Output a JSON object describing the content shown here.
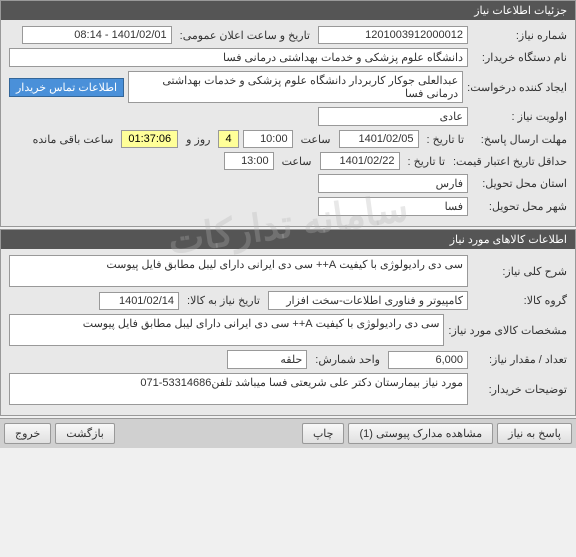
{
  "watermark": "سامانه تدارکات",
  "panel1": {
    "title": "جزئیات اطلاعات نیاز",
    "need_number_label": "شماره نیاز:",
    "need_number": "1201003912000012",
    "public_announce_datetime_label": "تاریخ و ساعت اعلان عمومی:",
    "public_announce_datetime": "1401/02/01 - 08:14",
    "buyer_name_label": "نام دستگاه خریدار:",
    "buyer_name": "دانشگاه علوم پزشکی و خدمات بهداشتی درمانی فسا",
    "requester_label": "ایجاد کننده درخواست:",
    "requester": "عبدالعلی جوکار کاربردار دانشگاه علوم پزشکی و خدمات بهداشتی درمانی فسا",
    "buyer_contact_label": "اطلاعات تماس خریدار",
    "priority_label": "اولویت نیاز :",
    "priority": "عادی",
    "response_deadline_label": "مهلت ارسال پاسخ:",
    "to_date_label": "تا تاریخ :",
    "response_date": "1401/02/05",
    "time_label": "ساعت",
    "response_time": "10:00",
    "days_remaining": "4",
    "days_and_label": "روز و",
    "countdown": "01:37:06",
    "remaining_label": "ساعت باقی مانده",
    "price_validity_label": "حداقل تاریخ اعتبار قیمت:",
    "price_validity_date": "1401/02/22",
    "price_validity_time": "13:00",
    "delivery_province_label": "استان محل تحویل:",
    "delivery_province": "فارس",
    "delivery_city_label": "شهر محل تحویل:",
    "delivery_city": "فسا"
  },
  "panel2": {
    "title": "اطلاعات کالاهای مورد نیاز",
    "general_desc_label": "شرح کلی نیاز:",
    "general_desc": "سی دی رادیولوژی با کیفیت A++ سی دی ایرانی  دارای لیبل مطابق فایل پیوست",
    "category_label": "گروه کالا:",
    "category": "کامپیوتر و فناوری اطلاعات-سخت افزار",
    "need_date_label": "تاریخ نیاز به کالا:",
    "need_date": "1401/02/14",
    "item_spec_label": "مشخصات کالای مورد نیاز:",
    "item_spec": "سی دی رادیولوژی با کیفیت A++ سی دی ایرانی  دارای لیبل مطابق فایل پیوست",
    "quantity_label": "تعداد / مقدار نیاز:",
    "quantity": "6,000",
    "unit_label": "واحد شمارش:",
    "unit": "حلقه",
    "buyer_notes_label": "توضیحات خریدار:",
    "buyer_notes": "مورد نیاز بیمارستان دکتر علی شریعتی فسا میباشد تلفن53314686-071"
  },
  "buttons": {
    "respond": "پاسخ به نیاز",
    "attachments": "مشاهده مدارک پیوستی (1)",
    "print": "چاپ",
    "back": "بازگشت",
    "exit": "خروج"
  }
}
